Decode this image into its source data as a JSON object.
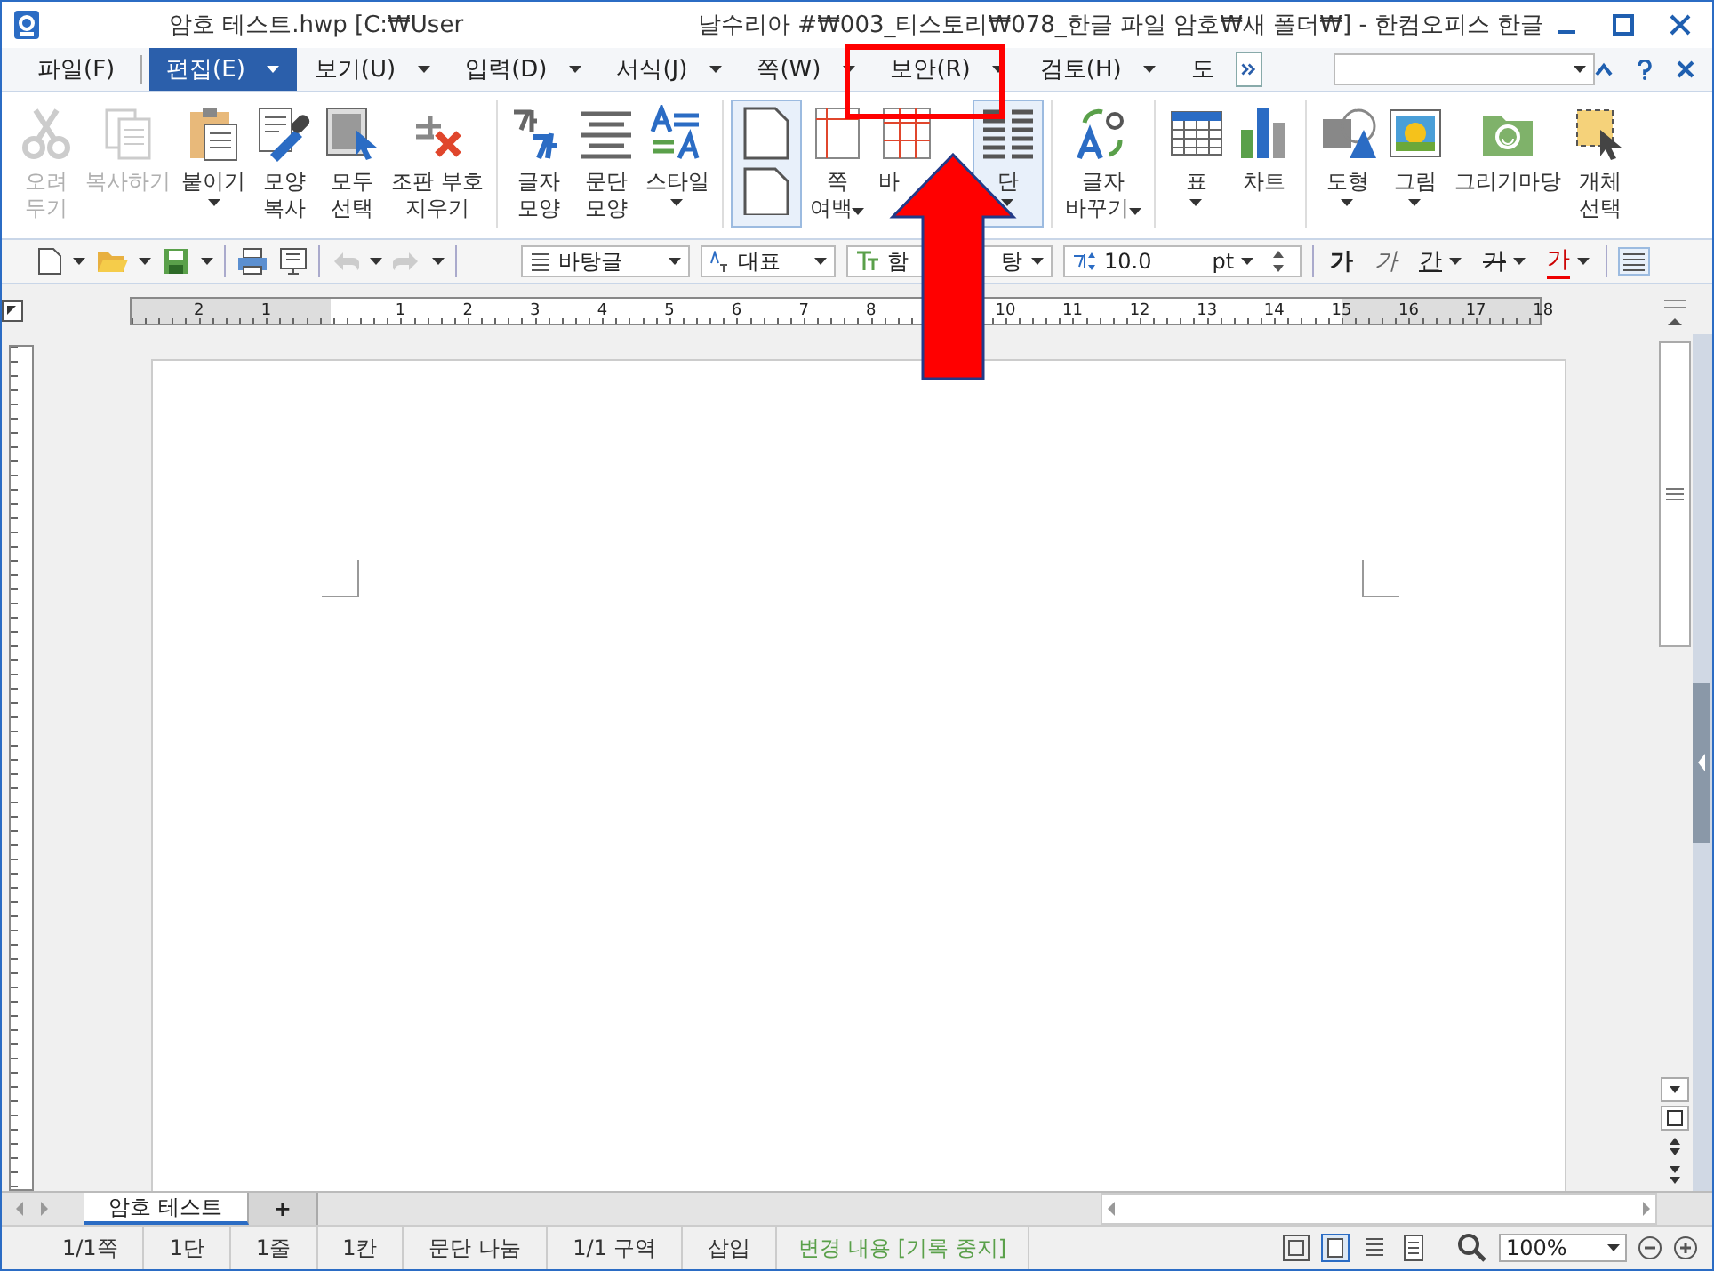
{
  "window": {
    "title_start": "암호 테스트.hwp [C:₩User",
    "title_end": "날수리아 #₩003_티스토리₩078_한글 파일 암호₩새 폴더₩] - 한컴오피스 한글"
  },
  "menu": {
    "tabs": [
      {
        "label": "파일(F)",
        "selected": false,
        "dropdown": false
      },
      {
        "label": "편집(E)",
        "selected": true,
        "dropdown": true
      },
      {
        "label": "보기(U)",
        "selected": false,
        "dropdown": true
      },
      {
        "label": "입력(D)",
        "selected": false,
        "dropdown": true
      },
      {
        "label": "서식(J)",
        "selected": false,
        "dropdown": true
      },
      {
        "label": "쪽(W)",
        "selected": false,
        "dropdown": true
      },
      {
        "label": "보안(R)",
        "selected": false,
        "dropdown": true
      },
      {
        "label": "검토(H)",
        "selected": false,
        "dropdown": true
      },
      {
        "label": "도",
        "selected": false,
        "dropdown": false
      }
    ]
  },
  "ribbon": {
    "groups": [
      [
        {
          "kind": "scissors",
          "lines": [
            "오려",
            "두기"
          ],
          "disabled": true,
          "dropdown": false,
          "selected": false
        },
        {
          "kind": "copy",
          "lines": [
            "복사하기"
          ],
          "disabled": true,
          "dropdown": false,
          "selected": false
        },
        {
          "kind": "clipboard",
          "lines": [
            "붙이기"
          ],
          "disabled": false,
          "dropdown": true,
          "selected": false
        },
        {
          "kind": "brush",
          "lines": [
            "모양",
            "복사"
          ],
          "disabled": false,
          "dropdown": false,
          "selected": false
        },
        {
          "kind": "select",
          "lines": [
            "모두",
            "선택"
          ],
          "disabled": false,
          "dropdown": false,
          "selected": false
        },
        {
          "kind": "erase",
          "lines": [
            "조판 부호",
            "지우기"
          ],
          "disabled": false,
          "dropdown": false,
          "selected": false
        }
      ],
      [
        {
          "kind": "char",
          "lines": [
            "글자",
            "모양"
          ],
          "disabled": false,
          "dropdown": false,
          "selected": false
        },
        {
          "kind": "para",
          "lines": [
            "문단",
            "모양"
          ],
          "disabled": false,
          "dropdown": false,
          "selected": false
        },
        {
          "kind": "style",
          "lines": [
            "스타일"
          ],
          "disabled": false,
          "dropdown": true,
          "selected": false
        }
      ],
      [
        {
          "kind": "page",
          "disabled": false,
          "dropdown": false,
          "selected": true
        },
        {
          "kind": "margin",
          "lines": [
            "쪽",
            "여백"
          ],
          "disabled": false,
          "dropdown": true,
          "selected": false
        },
        {
          "kind": "grid",
          "lines": [
            "바"
          ],
          "disabled": false,
          "dropdown": false,
          "selected": false
        },
        {
          "kind": "columns",
          "lines": [
            "단"
          ],
          "disabled": false,
          "dropdown": true,
          "selected": true
        }
      ],
      [
        {
          "kind": "replace",
          "lines": [
            "글자",
            "바꾸기"
          ],
          "disabled": false,
          "dropdown": true,
          "selected": false
        }
      ],
      [
        {
          "kind": "table",
          "lines": [
            "표"
          ],
          "disabled": false,
          "dropdown": true,
          "selected": false
        },
        {
          "kind": "chart",
          "lines": [
            "차트"
          ],
          "disabled": false,
          "dropdown": false,
          "selected": false
        }
      ],
      [
        {
          "kind": "shape",
          "lines": [
            "도형"
          ],
          "disabled": false,
          "dropdown": true,
          "selected": false
        },
        {
          "kind": "picture",
          "lines": [
            "그림"
          ],
          "disabled": false,
          "dropdown": true,
          "selected": false
        },
        {
          "kind": "gallery",
          "lines": [
            "그리기마당"
          ],
          "disabled": false,
          "dropdown": false,
          "selected": false
        },
        {
          "kind": "object",
          "lines": [
            "개체",
            "선택"
          ],
          "disabled": false,
          "dropdown": false,
          "selected": false
        }
      ]
    ]
  },
  "toolbar": {
    "style": "바탕글",
    "para_style": "대표",
    "font_start": "함",
    "font_end": "탕",
    "size": "10.0",
    "unit": "pt",
    "formats": [
      {
        "kind": "bold",
        "label": "가",
        "dropdown": false
      },
      {
        "kind": "italic",
        "label": "가",
        "dropdown": false
      },
      {
        "kind": "underline",
        "label": "간",
        "dropdown": true
      },
      {
        "kind": "strike",
        "label": "가",
        "dropdown": true
      },
      {
        "kind": "color",
        "label": "가",
        "dropdown": true
      }
    ]
  },
  "ruler": {
    "left_labels": [
      "2",
      "1"
    ],
    "labels_before": [
      "1",
      "2",
      "3",
      "4",
      "5",
      "6",
      "7",
      "8"
    ],
    "labels_after": [
      "10",
      "11",
      "12",
      "13",
      "14",
      "15",
      "16",
      "17",
      "18"
    ]
  },
  "doc_tabs": [
    {
      "label": "암호 테스트",
      "selected": true
    },
    {
      "label": "+",
      "selected": false
    }
  ],
  "status_bar": {
    "fields": [
      "1/1쪽",
      "1단",
      "1줄",
      "1칸",
      "문단 나눔",
      "1/1 구역",
      "삽입"
    ],
    "track_changes": "변경 내용 [기록 중지]",
    "zoom": "100%"
  }
}
